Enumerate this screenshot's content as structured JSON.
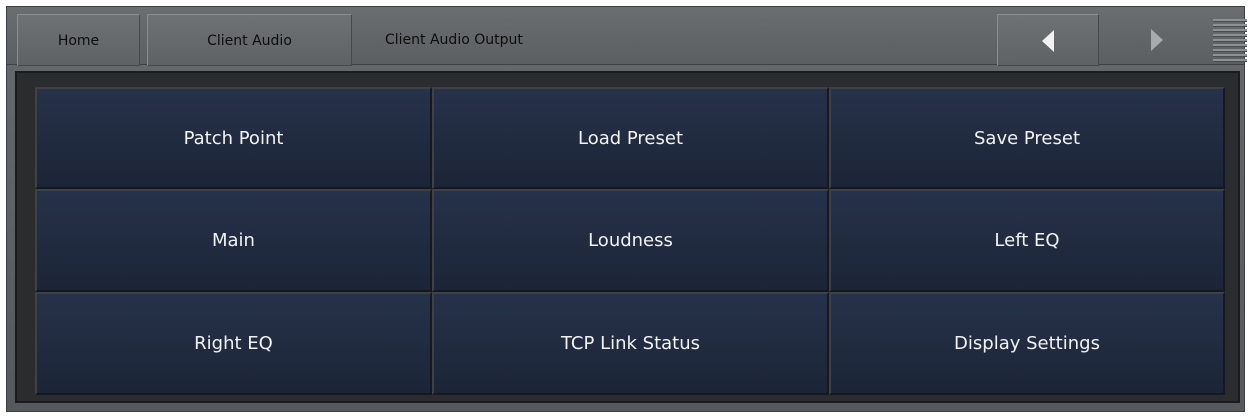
{
  "header": {
    "breadcrumb": {
      "home": "Home",
      "parent": "Client Audio",
      "current": "Client Audio Output"
    },
    "nav": {
      "back_icon": "triangle-left-icon",
      "forward_icon": "triangle-right-icon",
      "menu_icon": "menu-lines-icon"
    }
  },
  "menu": {
    "items": [
      {
        "label": "Patch Point"
      },
      {
        "label": "Load Preset"
      },
      {
        "label": "Save Preset"
      },
      {
        "label": "Main"
      },
      {
        "label": "Loudness"
      },
      {
        "label": "Left EQ"
      },
      {
        "label": "Right EQ"
      },
      {
        "label": "TCP Link Status"
      },
      {
        "label": "Display Settings"
      }
    ]
  },
  "colors": {
    "chrome": "#5e6264",
    "tile": "#1f2a3d",
    "tile_text": "#f2f2f2",
    "header_text": "#0d0d0d"
  }
}
